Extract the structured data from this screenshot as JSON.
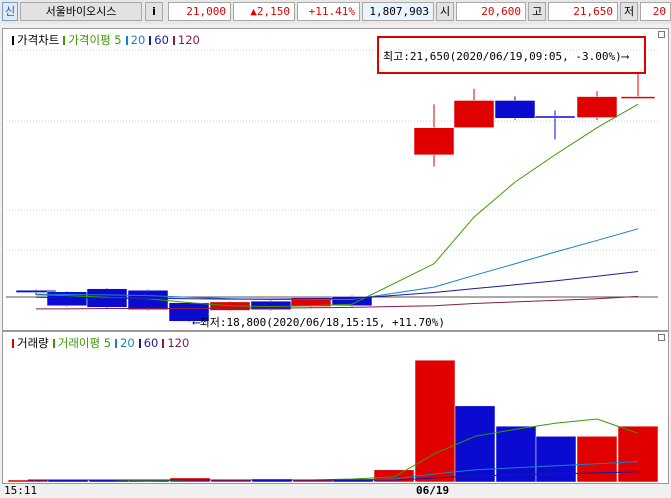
{
  "header": {
    "badge": "신",
    "name": "서울바이오시스",
    "info": "i",
    "price": "21,000",
    "change": "▲2,150",
    "change_pct": "+11.41%",
    "volume": "1,807,903",
    "open_label": "시",
    "open": "20,600",
    "high_label": "고",
    "high": "21,650",
    "low_label": "저",
    "low": "20"
  },
  "chart_data": [
    {
      "type": "candlestick",
      "legend": [
        {
          "label": "가격차트",
          "color": "#000000"
        },
        {
          "label": "가격이평 5",
          "color": "#3a9a00"
        },
        {
          "label": "20",
          "color": "#1a7fd0"
        },
        {
          "label": "60",
          "color": "#1a1aa0"
        },
        {
          "label": "120",
          "color": "#8a1a4a"
        }
      ],
      "ylim": [
        18400,
        22000
      ],
      "candles": [
        {
          "open": 18860,
          "high": 18870,
          "low": 18800,
          "close": 18830,
          "color": "blue"
        },
        {
          "open": 18840,
          "high": 18850,
          "low": 18650,
          "close": 18660,
          "color": "blue"
        },
        {
          "open": 18880,
          "high": 18890,
          "low": 18630,
          "close": 18640,
          "color": "blue"
        },
        {
          "open": 18860,
          "high": 18870,
          "low": 18600,
          "close": 18610,
          "color": "blue"
        },
        {
          "open": 18700,
          "high": 18710,
          "low": 18450,
          "close": 18460,
          "color": "blue"
        },
        {
          "open": 18600,
          "high": 18720,
          "low": 18590,
          "close": 18710,
          "color": "red"
        },
        {
          "open": 18720,
          "high": 18730,
          "low": 18600,
          "close": 18610,
          "color": "blue"
        },
        {
          "open": 18650,
          "high": 18780,
          "low": 18640,
          "close": 18770,
          "color": "red"
        },
        {
          "open": 18780,
          "high": 18790,
          "low": 18650,
          "close": 18660,
          "color": "blue"
        },
        {
          "open": 20600,
          "high": 21250,
          "low": 20450,
          "close": 20950,
          "color": "red"
        },
        {
          "open": 20950,
          "high": 21450,
          "low": 20950,
          "close": 21300,
          "color": "red"
        },
        {
          "open": 21300,
          "high": 21350,
          "low": 21050,
          "close": 21070,
          "color": "blue"
        },
        {
          "open": 21100,
          "high": 21170,
          "low": 20800,
          "close": 21100,
          "color": "blue"
        },
        {
          "open": 21080,
          "high": 21420,
          "low": 21050,
          "close": 21350,
          "color": "red"
        },
        {
          "open": 21350,
          "high": 21650,
          "low": 21350,
          "close": 21350,
          "color": "red"
        }
      ],
      "ma5": [
        18800,
        18790,
        18770,
        18750,
        18700,
        18660,
        18650,
        18660,
        18680,
        19200,
        19800,
        20250,
        20600,
        20950,
        21250
      ],
      "ma20": [
        18810,
        18805,
        18800,
        18790,
        18770,
        18750,
        18740,
        18740,
        18740,
        18900,
        19050,
        19200,
        19350,
        19500,
        19650
      ],
      "ma60": [
        18770,
        18765,
        18760,
        18755,
        18750,
        18745,
        18745,
        18750,
        18755,
        18830,
        18880,
        18930,
        18980,
        19040,
        19100
      ],
      "ma120": [
        18620,
        18620,
        18625,
        18625,
        18625,
        18630,
        18630,
        18635,
        18640,
        18660,
        18690,
        18710,
        18730,
        18750,
        18780
      ],
      "annotations": {
        "high": "최고:21,650(2020/06/19,09:05, -3.00%)",
        "low": "최저:18,800(2020/06/18,15:15, +11.70%)"
      }
    },
    {
      "type": "bar",
      "legend": [
        {
          "label": "거래량",
          "color": "#e00000"
        },
        {
          "label": "거래이평 5",
          "color": "#3a9a00"
        },
        {
          "label": "20",
          "color": "#1a7fd0"
        },
        {
          "label": "60",
          "color": "#1a1aa0"
        },
        {
          "label": "120",
          "color": "#8a1a4a"
        }
      ],
      "ylim": [
        0,
        130
      ],
      "values": [
        2,
        1,
        1,
        1,
        4,
        2,
        3,
        2,
        3,
        12,
        120,
        75,
        55,
        45,
        45,
        55
      ],
      "colors": [
        "red",
        "blue",
        "blue",
        "blue",
        "red",
        "red",
        "blue",
        "red",
        "blue",
        "red",
        "red",
        "blue",
        "blue",
        "blue",
        "red",
        "red"
      ],
      "ma5": [
        2,
        2,
        2,
        1,
        2,
        2,
        2,
        2,
        3,
        5,
        28,
        45,
        52,
        58,
        62,
        48
      ],
      "ma20": [
        2,
        2,
        2,
        2,
        2,
        2,
        2,
        2,
        2,
        3,
        8,
        12,
        14,
        16,
        18,
        20
      ],
      "ma60": [
        2,
        2,
        2,
        2,
        2,
        2,
        2,
        2,
        2,
        2,
        4,
        6,
        7,
        8,
        9,
        10
      ]
    }
  ],
  "xaxis": {
    "start": "15:11",
    "date": "06/19"
  }
}
